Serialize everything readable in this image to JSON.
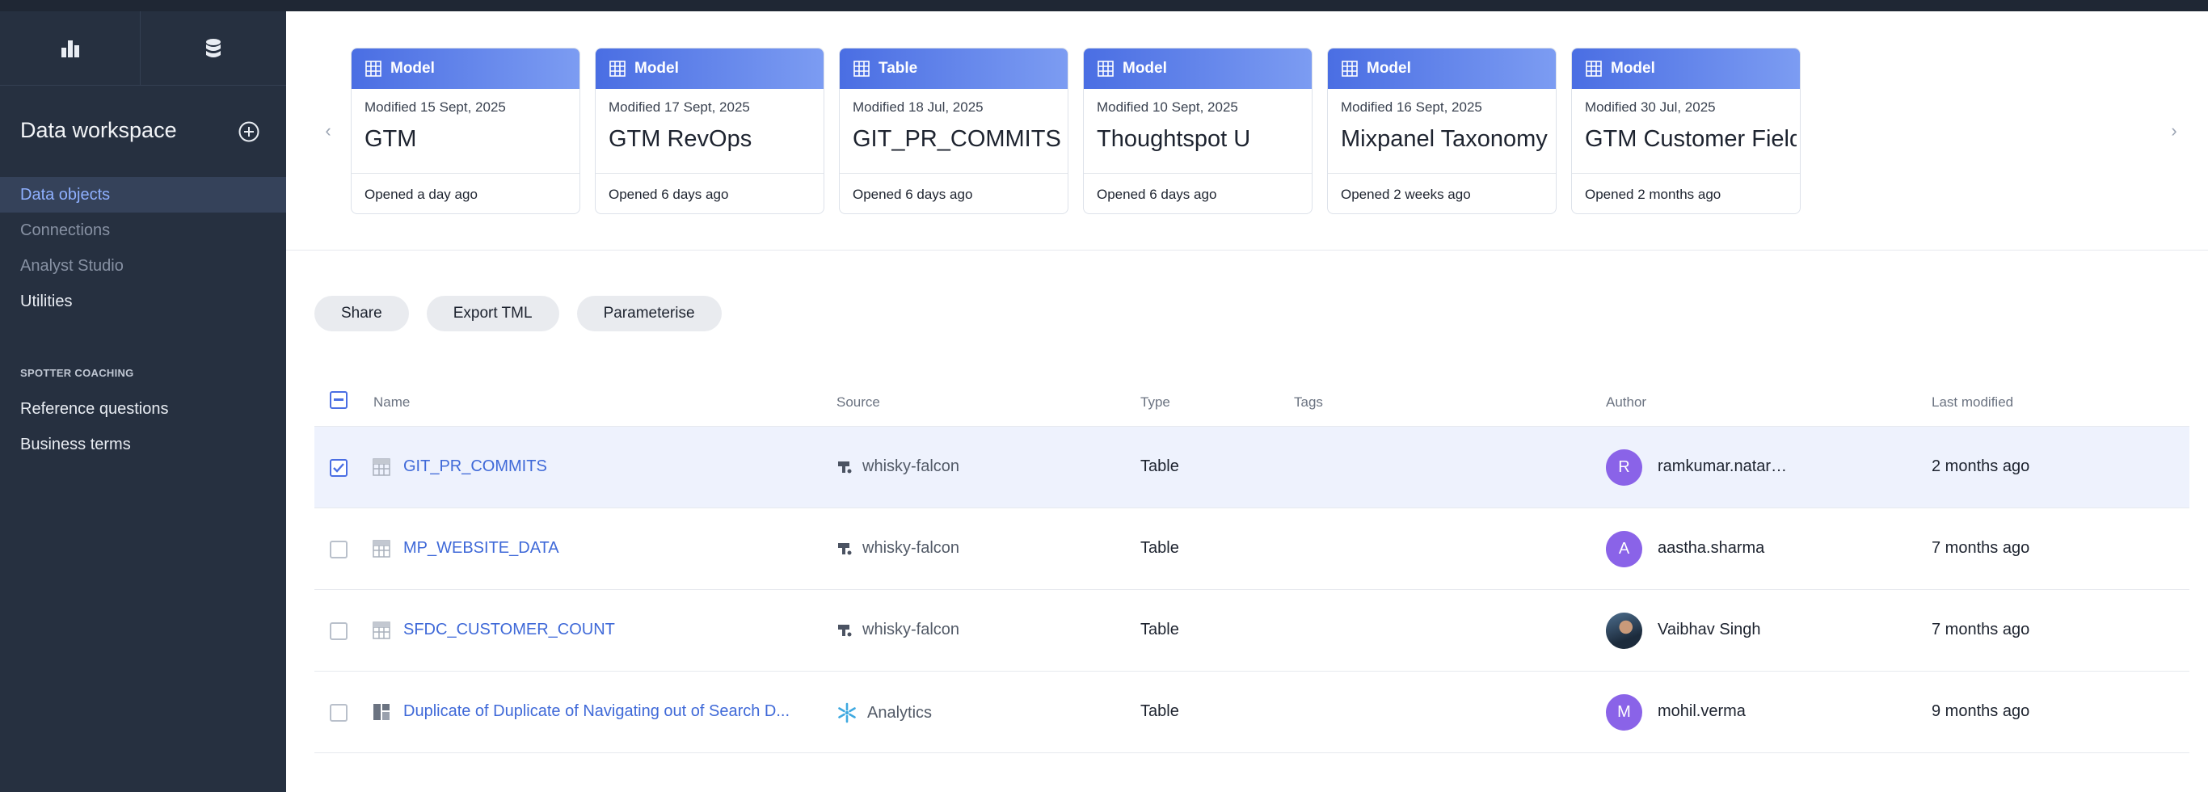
{
  "colors": {
    "accent": "#4a6ee3",
    "sidebar_bg": "#263040",
    "avatar_purple": "#8a63e8"
  },
  "sidebar": {
    "icons": [
      "bar-chart-icon",
      "database-icon"
    ],
    "title": "Data workspace",
    "nav": [
      {
        "label": "Data objects",
        "state": "active"
      },
      {
        "label": "Connections",
        "state": "muted"
      },
      {
        "label": "Analyst Studio",
        "state": "muted"
      },
      {
        "label": "Utilities",
        "state": "normal"
      }
    ],
    "section_label": "SPOTTER COACHING",
    "coaching": [
      {
        "label": "Reference questions"
      },
      {
        "label": "Business terms"
      }
    ]
  },
  "recent": {
    "cards": [
      {
        "type": "Model",
        "modified": "Modified 15 Sept, 2025",
        "name": "GTM",
        "opened": "Opened a day ago"
      },
      {
        "type": "Model",
        "modified": "Modified 17 Sept, 2025",
        "name": "GTM RevOps",
        "opened": "Opened 6 days ago"
      },
      {
        "type": "Table",
        "modified": "Modified 18 Jul, 2025",
        "name": "GIT_PR_COMMITS",
        "opened": "Opened 6 days ago"
      },
      {
        "type": "Model",
        "modified": "Modified 10 Sept, 2025",
        "name": "Thoughtspot U",
        "opened": "Opened 6 days ago"
      },
      {
        "type": "Model",
        "modified": "Modified 16 Sept, 2025",
        "name": "Mixpanel Taxonomy",
        "opened": "Opened 2 weeks ago"
      },
      {
        "type": "Model",
        "modified": "Modified 30 Jul, 2025",
        "name": "GTM Customer Fields",
        "opened": "Opened 2 months ago"
      }
    ]
  },
  "actions": {
    "share": "Share",
    "export": "Export TML",
    "parameterise": "Parameterise"
  },
  "table": {
    "headers": {
      "name": "Name",
      "source": "Source",
      "type": "Type",
      "tags": "Tags",
      "author": "Author",
      "modified": "Last modified"
    },
    "rows": [
      {
        "selected": true,
        "icon": "table-icon",
        "name": "GIT_PR_COMMITS",
        "source_icon": "connection-icon",
        "source": "whisky-falcon",
        "type": "Table",
        "author_initial": "R",
        "author": "ramkumar.natar…",
        "modified": "2 months ago"
      },
      {
        "selected": false,
        "icon": "table-icon",
        "name": "MP_WEBSITE_DATA",
        "source_icon": "connection-icon",
        "source": "whisky-falcon",
        "type": "Table",
        "author_initial": "A",
        "author": "aastha.sharma",
        "modified": "7 months ago"
      },
      {
        "selected": false,
        "icon": "table-icon",
        "name": "SFDC_CUSTOMER_COUNT",
        "source_icon": "connection-icon",
        "source": "whisky-falcon",
        "type": "Table",
        "author_initial": "",
        "author": "Vaibhav Singh",
        "modified": "7 months ago"
      },
      {
        "selected": false,
        "icon": "liveboard-icon",
        "name": "Duplicate of Duplicate of Navigating out of Search D...",
        "source_icon": "snowflake-icon",
        "source": "Analytics",
        "type": "Table",
        "author_initial": "M",
        "author": "mohil.verma",
        "modified": "9 months ago"
      }
    ]
  }
}
